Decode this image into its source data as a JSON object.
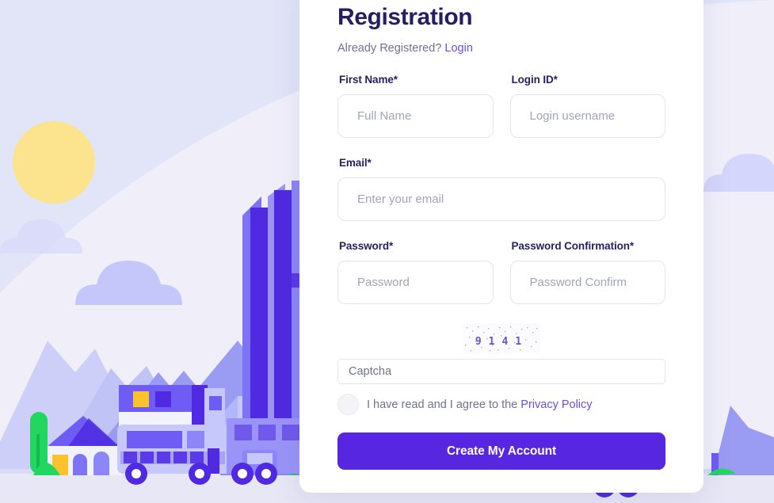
{
  "page": {
    "title": "Registration",
    "already_registered_text": "Already Registered?",
    "login_link": "Login"
  },
  "form": {
    "fields": [
      {
        "name": "first_name",
        "label": "First Name*",
        "placeholder": "Full Name",
        "value": ""
      },
      {
        "name": "login_id",
        "label": "Login ID*",
        "placeholder": "Login username",
        "value": ""
      },
      {
        "name": "email",
        "label": "Email*",
        "placeholder": "Enter your email",
        "value": ""
      },
      {
        "name": "password",
        "label": "Password*",
        "placeholder": "Password",
        "value": ""
      },
      {
        "name": "password_confirmation",
        "label": "Password Confirmation*",
        "placeholder": "Password Confirm",
        "value": ""
      }
    ],
    "captcha": {
      "code": "9141",
      "input_placeholder": "Captcha",
      "input_value": ""
    },
    "agreement": {
      "text": "I have read and I agree to the",
      "link": "Privacy Policy",
      "checked": false
    },
    "submit_label": "Create My Account"
  },
  "colors": {
    "accent": "#5726e0",
    "link": "#6c4de6",
    "heading": "#241f62",
    "muted": "#6e7191",
    "placeholder": "#a0a3bd",
    "sky": "#e2e4f8",
    "sky_light": "#f0eff9",
    "sun": "#fce38e",
    "building_dark": "#4f2ae0",
    "building_mid": "#6e5cf5",
    "building_light": "#b3b6f9",
    "mountain": "#9a9cf3",
    "mountain_light": "#cdcff8",
    "tree_green": "#21d760",
    "window_yellow": "#fcc22c"
  }
}
